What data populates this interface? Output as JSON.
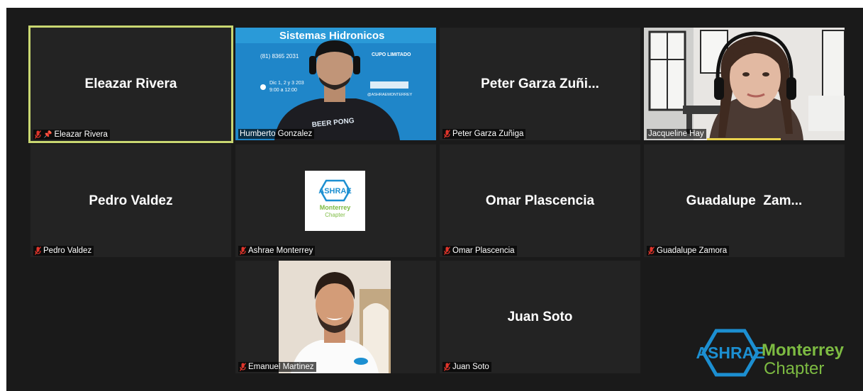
{
  "participants": [
    {
      "display": "Eleazar Rivera",
      "label": "Eleazar Rivera",
      "muted": true,
      "pinned": true,
      "active": true
    },
    {
      "display": "",
      "label": "Humberto Gonzalez",
      "muted": false,
      "video": true
    },
    {
      "display": "Peter Garza Zuñi...",
      "label": "Peter Garza Zuñiga",
      "muted": true
    },
    {
      "display": "",
      "label": "Jacqueline Hay",
      "muted": false,
      "video": true
    },
    {
      "display": "Pedro Valdez",
      "label": "Pedro Valdez",
      "muted": true
    },
    {
      "display": "",
      "label": "Ashrae Monterrey",
      "muted": true
    },
    {
      "display": "Omar Plascencia",
      "label": "Omar Plascencia",
      "muted": true
    },
    {
      "display": "Guadalupe  Zam...",
      "label": "Guadalupe Zamora",
      "muted": true
    },
    {
      "display": "",
      "label": "Emanuel Martinez",
      "muted": true,
      "video": true
    },
    {
      "display": "Juan Soto",
      "label": "Juan Soto",
      "muted": true
    }
  ],
  "poster": {
    "title": "Sistemas Hidronicos",
    "phone": "(81) 8365 2031",
    "cupo": "CUPO LIMITADO",
    "dates": "Dic 1, 2 y 3  203",
    "hours": "9:00 a 12:00",
    "handle": "@ASHRAEMONTERREY"
  },
  "shirt_text": "BEER PONG",
  "logo": {
    "brand": "ASHRAE",
    "city": "Monterrey",
    "chapter": "Chapter"
  },
  "colors": {
    "accent": "#c9d771",
    "speaker": "#e9d24d",
    "mute": "#e0352b",
    "logo_blue": "#1c8fd1",
    "logo_green": "#7dbb42"
  }
}
